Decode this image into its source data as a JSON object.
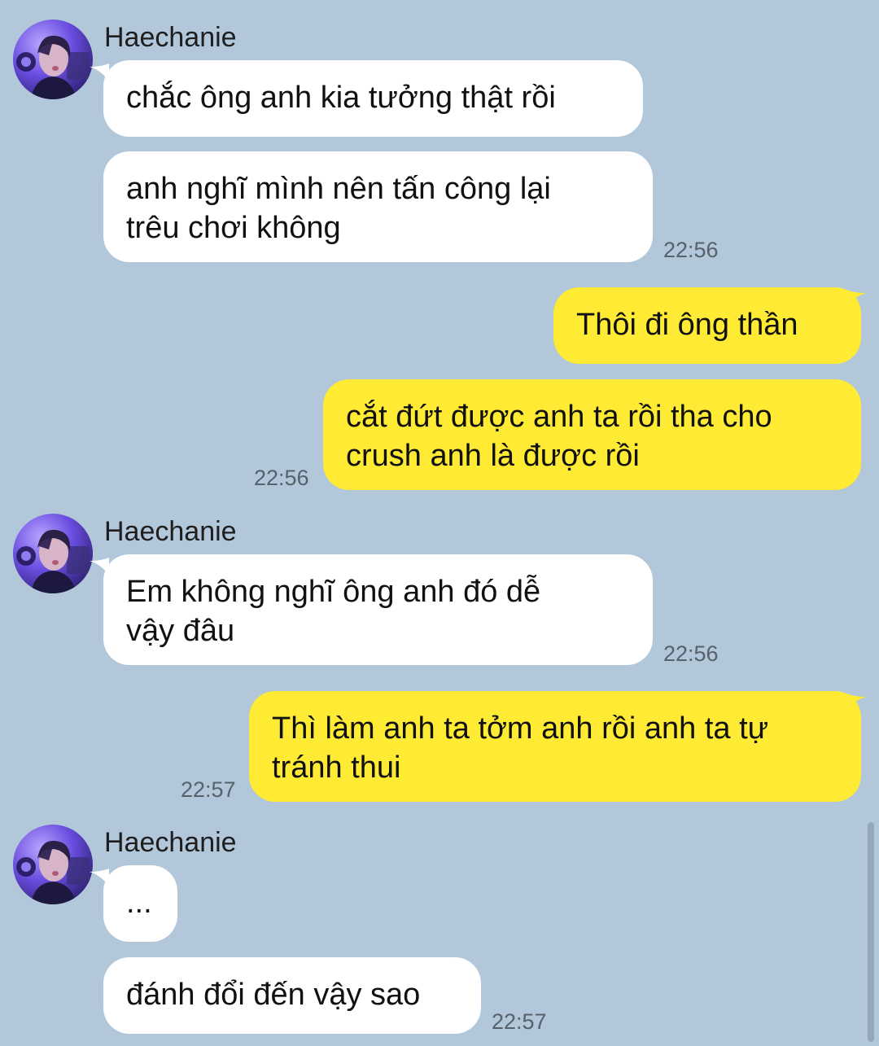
{
  "chat": {
    "contact_name": "Haechanie",
    "colors": {
      "background": "#b2c7d9",
      "incoming_bubble": "#ffffff",
      "outgoing_bubble": "#ffeb33",
      "timestamp_text": "#56616b"
    },
    "messages": [
      {
        "id": 1,
        "direction": "incoming",
        "sender": "Haechanie",
        "text": "chắc ông anh kia tưởng thật rồi"
      },
      {
        "id": 2,
        "direction": "incoming",
        "text": "anh nghĩ mình nên tấn công lại\ntrêu chơi không",
        "time": "22:56"
      },
      {
        "id": 3,
        "direction": "outgoing",
        "text": "Thôi đi ông thần"
      },
      {
        "id": 4,
        "direction": "outgoing",
        "text": "cắt đứt được anh ta rồi tha cho\ncrush anh là được rồi",
        "time": "22:56"
      },
      {
        "id": 5,
        "direction": "incoming",
        "sender": "Haechanie",
        "text": "Em không nghĩ ông anh đó dễ\nvậy đâu",
        "time": "22:56"
      },
      {
        "id": 6,
        "direction": "outgoing",
        "text": "Thì làm anh ta tởm anh rồi anh ta tự\ntránh thui",
        "time": "22:57"
      },
      {
        "id": 7,
        "direction": "incoming",
        "sender": "Haechanie",
        "text": "..."
      },
      {
        "id": 8,
        "direction": "incoming",
        "text": "đánh đổi đến vậy sao",
        "time": "22:57"
      }
    ]
  }
}
